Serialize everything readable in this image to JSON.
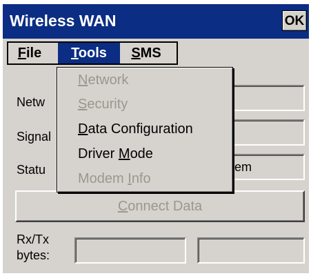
{
  "window": {
    "title": "Wireless WAN",
    "ok_label": "OK"
  },
  "menubar": {
    "file": {
      "pre": "",
      "accel": "F",
      "post": "ile"
    },
    "tools": {
      "pre": "",
      "accel": "T",
      "post": "ools"
    },
    "sms": {
      "pre": "",
      "accel": "S",
      "post": "MS"
    }
  },
  "form": {
    "network_label": "Netw",
    "signal_label": "Signal",
    "status_label": "Statu",
    "status_value": "em",
    "connect": {
      "pre": "",
      "accel": "C",
      "post": "onnect Data"
    },
    "rxtx_label_line1": "Rx/Tx",
    "rxtx_label_line2": "bytes:"
  },
  "tools_menu": {
    "items": [
      {
        "pre": "",
        "accel": "N",
        "post": "etwork",
        "enabled": false
      },
      {
        "pre": "",
        "accel": "S",
        "post": "ecurity",
        "enabled": false
      },
      {
        "pre": "",
        "accel": "D",
        "post": "ata Configuration",
        "enabled": true
      },
      {
        "pre": "Driver ",
        "accel": "M",
        "post": "ode",
        "enabled": true
      },
      {
        "pre": "Modem ",
        "accel": "I",
        "post": "nfo",
        "enabled": false
      }
    ]
  }
}
